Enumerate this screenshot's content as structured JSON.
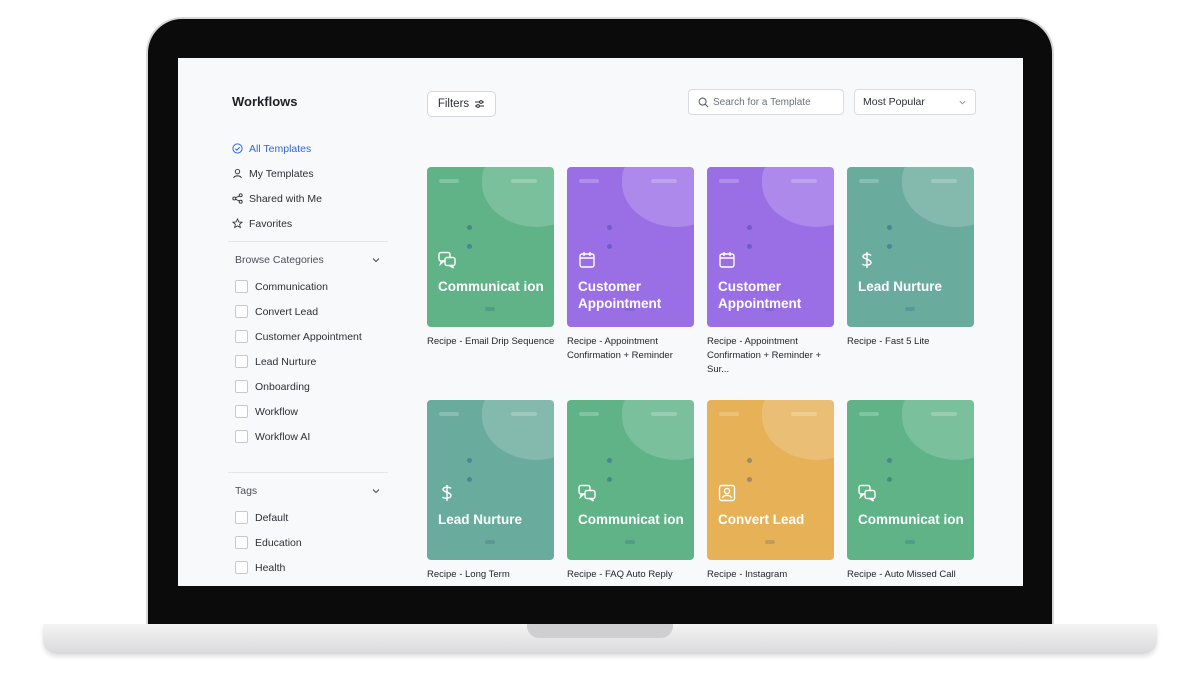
{
  "sidebar": {
    "title": "Workflows",
    "nav": [
      {
        "label": "All Templates",
        "icon": "check-circle-icon"
      },
      {
        "label": "My Templates",
        "icon": "user-icon"
      },
      {
        "label": "Shared with Me",
        "icon": "share-icon"
      },
      {
        "label": "Favorites",
        "icon": "star-icon"
      }
    ],
    "categories": {
      "header": "Browse Categories",
      "items": [
        "Communication",
        "Convert Lead",
        "Customer Appointment",
        "Lead Nurture",
        "Onboarding",
        "Workflow",
        "Workflow AI"
      ]
    },
    "tags": {
      "header": "Tags",
      "items": [
        "Default",
        "Education",
        "Health"
      ]
    }
  },
  "toolbar": {
    "filters_label": "Filters",
    "search_placeholder": "Search for a Template",
    "sort_value": "Most Popular"
  },
  "colors": {
    "green": "#5fb387",
    "purple": "#9a6fe6",
    "teal": "#69ab9d",
    "orange": "#e6b157",
    "accent": "#2f66e0"
  },
  "cards": [
    {
      "label": "Communicat ion",
      "caption": "Recipe - Email Drip Sequence",
      "icon": "chat-icon"
    },
    {
      "label": "Customer Appointment",
      "caption": "Recipe - Appointment Confirmation + Reminder",
      "icon": "calendar-icon"
    },
    {
      "label": "Customer Appointment",
      "caption": "Recipe - Appointment Confirmation + Reminder + Sur...",
      "icon": "calendar-icon"
    },
    {
      "label": "Lead Nurture",
      "caption": "Recipe - Fast 5 Lite",
      "icon": "dollar-icon"
    },
    {
      "label": "Lead Nurture",
      "caption": "Recipe - Long Term",
      "icon": "dollar-icon"
    },
    {
      "label": "Communicat ion",
      "caption": "Recipe - FAQ Auto Reply",
      "icon": "chat-icon"
    },
    {
      "label": "Convert Lead",
      "caption": "Recipe - Instagram",
      "icon": "contact-icon"
    },
    {
      "label": "Communicat ion",
      "caption": "Recipe - Auto Missed Call",
      "icon": "chat-icon"
    }
  ]
}
